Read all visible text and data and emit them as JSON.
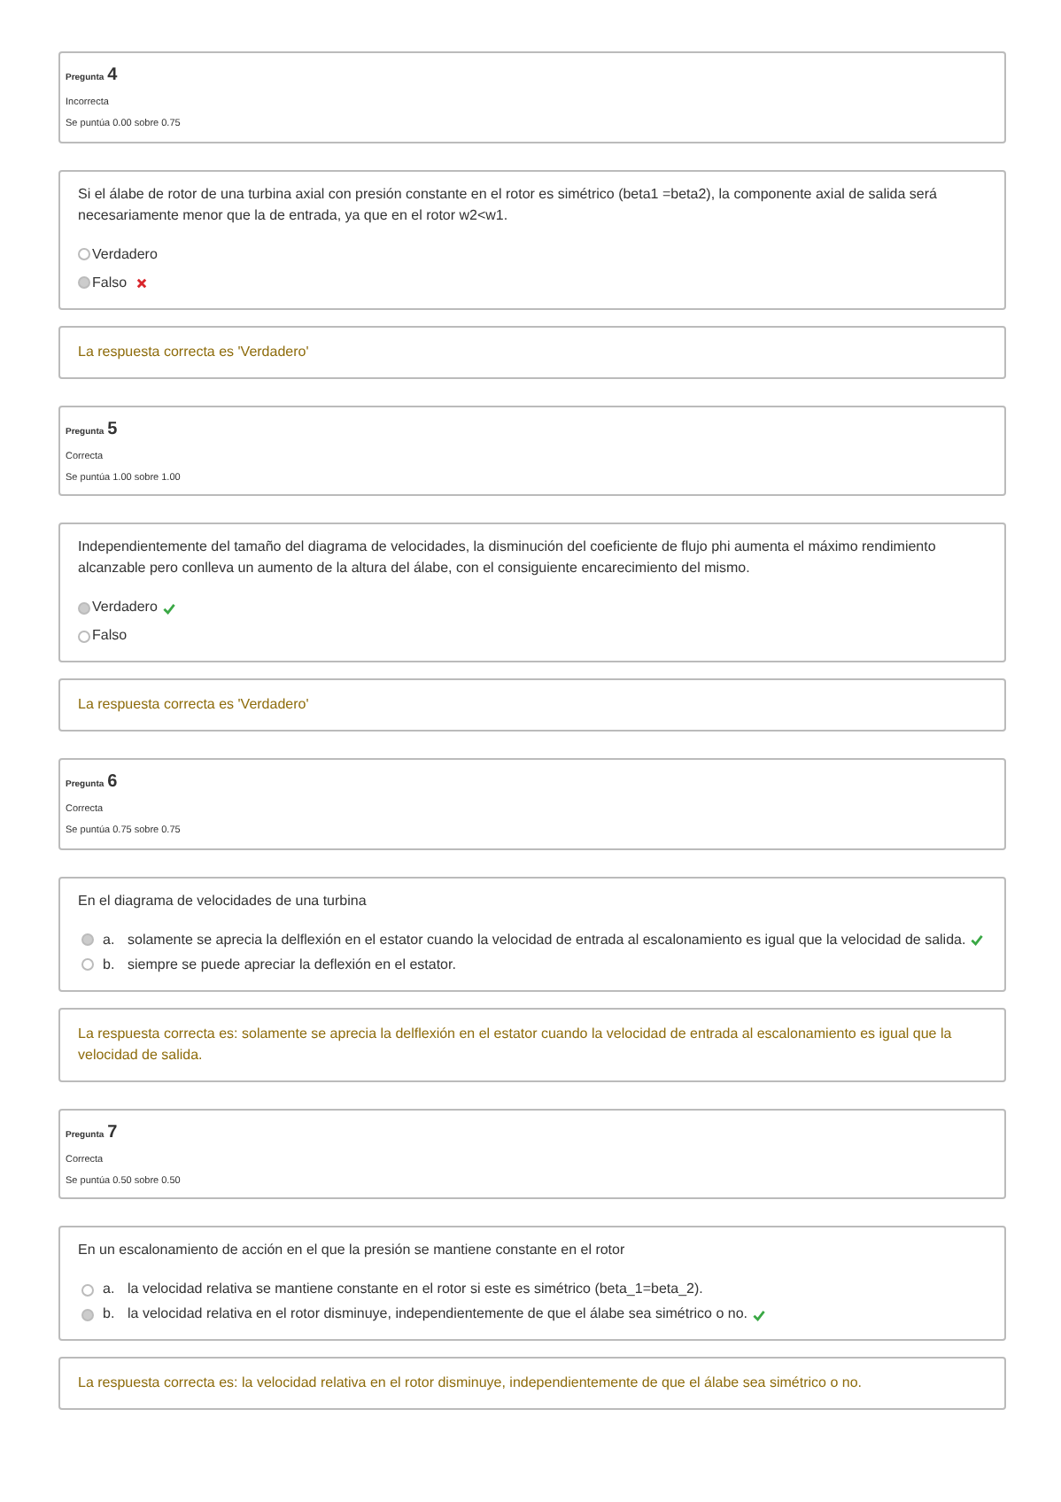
{
  "questions": [
    {
      "label": "Pregunta",
      "number": "4",
      "state": "Incorrecta",
      "grade": "Se puntúa 0.00 sobre 0.75",
      "text": "Si el álabe de rotor de una turbina axial con presión constante en el rotor es simétrico (beta1 =beta2), la componente axial de salida será necesariamente menor que la de entrada, ya que en el rotor w2<w1.",
      "options": [
        {
          "text": "Verdadero",
          "selected": false,
          "correct": false,
          "incorrect": false
        },
        {
          "text": "Falso",
          "selected": true,
          "correct": false,
          "incorrect": true
        }
      ],
      "feedback": "La respuesta correcta es 'Verdadero'"
    },
    {
      "label": "Pregunta",
      "number": "5",
      "state": "Correcta",
      "grade": "Se puntúa 1.00 sobre 1.00",
      "text": "Independientemente del tamaño del diagrama de velocidades, la disminución del coeficiente de flujo phi aumenta el máximo rendimiento alcanzable pero conlleva un aumento de la altura del álabe, con el consiguiente encarecimiento del mismo.",
      "options": [
        {
          "text": "Verdadero",
          "selected": true,
          "correct": true,
          "incorrect": false
        },
        {
          "text": "Falso",
          "selected": false,
          "correct": false,
          "incorrect": false
        }
      ],
      "feedback": "La respuesta correcta es 'Verdadero'"
    },
    {
      "label": "Pregunta",
      "number": "6",
      "state": "Correcta",
      "grade": "Se puntúa 0.75 sobre 0.75",
      "text": "En el diagrama de velocidades de una turbina",
      "options": [
        {
          "letter": "a.",
          "text": "solamente se aprecia la delflexión en el estator cuando la velocidad de entrada al escalonamiento es igual que la velocidad de salida.",
          "selected": true,
          "correct": true,
          "incorrect": false
        },
        {
          "letter": "b.",
          "text": "siempre se puede apreciar la deflexión en el estator.",
          "selected": false,
          "correct": false,
          "incorrect": false
        }
      ],
      "feedback": "La respuesta correcta es: solamente se aprecia la delflexión en el estator cuando la velocidad de entrada al escalonamiento es igual que la velocidad de salida."
    },
    {
      "label": "Pregunta",
      "number": "7",
      "state": "Correcta",
      "grade": "Se puntúa 0.50 sobre 0.50",
      "text": "En un escalonamiento de acción en el que la presión se mantiene constante en el rotor",
      "options": [
        {
          "letter": "a.",
          "text": "la velocidad relativa se mantiene constante en el rotor si este es simétrico (beta_1=beta_2).",
          "selected": false,
          "correct": false,
          "incorrect": false
        },
        {
          "letter": "b.",
          "text": "la velocidad relativa en el rotor disminuye, independientemente de que el álabe sea simétrico o no.",
          "selected": true,
          "correct": true,
          "incorrect": false
        }
      ],
      "feedback": "La respuesta correcta es: la velocidad relativa en el rotor disminuye, independientemente de que el álabe sea simétrico o no."
    }
  ]
}
